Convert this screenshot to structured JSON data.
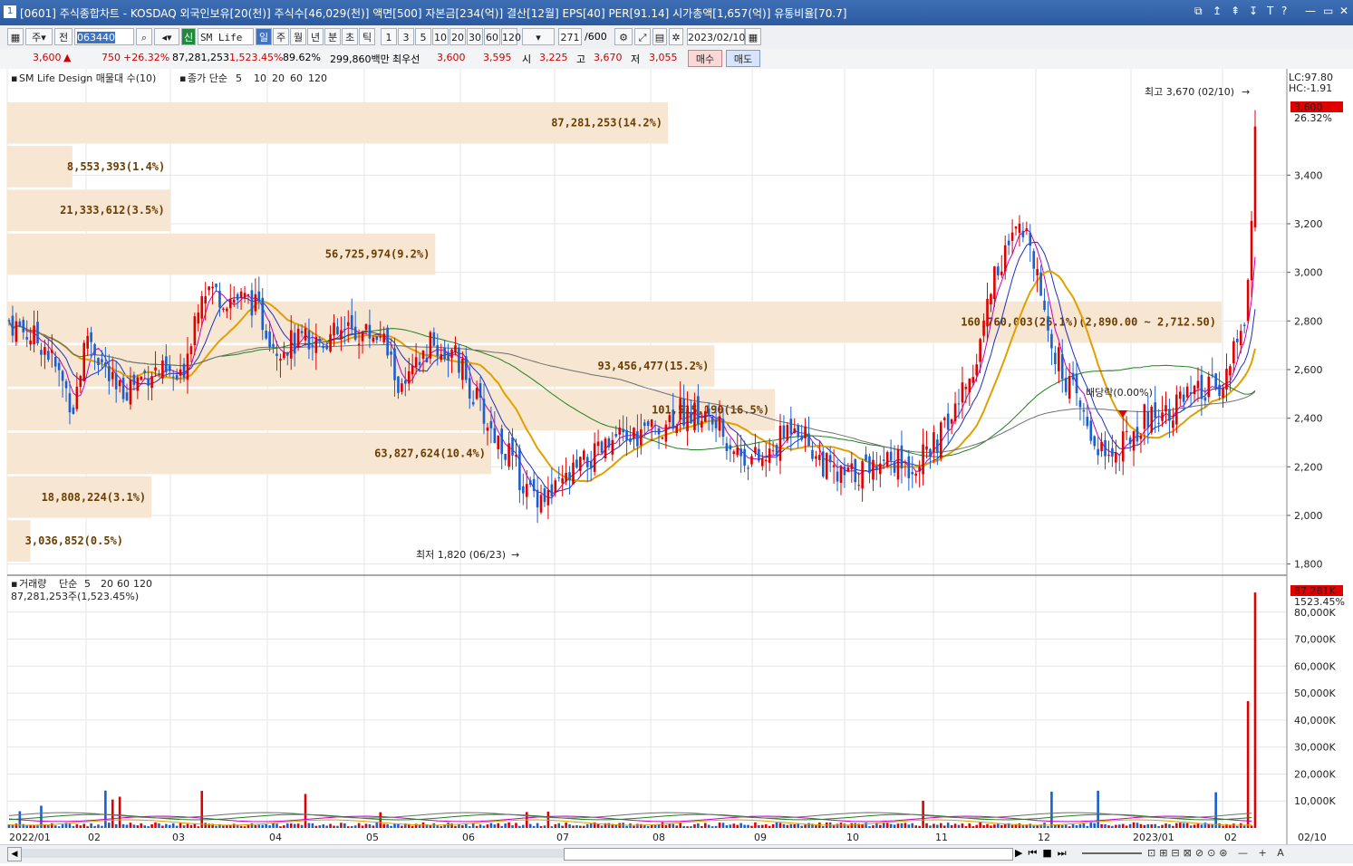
{
  "window": {
    "number": "1",
    "title": "[0601] 주식종합차트 - KOSDAQ 외국인보유[20(천)] 주식수[46,029(천)] 액면[500] 자본금[234(억)] 결산[12월] EPS[40] PER[91.14] 시가총액[1,657(억)] 유통비율[70.7]",
    "controls": [
      "⧉",
      "↥",
      "⇞",
      "↧",
      "T",
      "?",
      "—",
      "▭",
      "✕"
    ]
  },
  "toolbar": {
    "period_label": "주",
    "all_label": "전",
    "code": "063440",
    "badge_new": "신",
    "stock_name": "SM Life De",
    "tabs": [
      "일",
      "주",
      "월",
      "년",
      "분",
      "초",
      "틱"
    ],
    "active_tab": "일",
    "intervals": [
      "1",
      "3",
      "5",
      "10",
      "20",
      "30",
      "60",
      "120"
    ],
    "count": "271",
    "count_total": "/600",
    "date": "2023/02/10"
  },
  "info": {
    "price": "3,600",
    "change_arrow": "▲",
    "change": "750",
    "change_pct": "+26.32%",
    "volume": "87,281,253",
    "volume_pct": "1,523.45%",
    "turnover_pct": "89.62%",
    "amount": "299,860백만",
    "best_quote_label": "최우선",
    "ask": "3,600",
    "bid": "3,595",
    "open_label": "시",
    "open": "3,225",
    "high_label": "고",
    "high": "3,670",
    "low_label": "저",
    "low": "3,055",
    "buy_button": "매수",
    "sell_button": "매도"
  },
  "price_panel": {
    "legend_name": "SM Life Design 매물대 수(10)",
    "legend_ma_label": "종가 단순",
    "ma_periods": [
      "5",
      "10",
      "20",
      "60",
      "120"
    ],
    "ma_colors": [
      "#c000c0",
      "#1f2fbf",
      "#e0a000",
      "#208020",
      "#707070"
    ],
    "lc": "LC:97.80",
    "hc": "HC:-1.91",
    "current_tag": "3,600",
    "current_pct": "26.32%",
    "high_note": "최고 3,670 (02/10)",
    "low_note": "최저 1,820 (06/23)",
    "annotation": "배당락(0.00%)",
    "volume_profile": [
      {
        "label": "87,281,253(14.2%)",
        "upper": 3700,
        "lower": 3530,
        "pct": 14.2
      },
      {
        "label": "8,553,393(1.4%)",
        "upper": 3520,
        "lower": 3350,
        "pct": 1.4
      },
      {
        "label": "21,333,612(3.5%)",
        "upper": 3340,
        "lower": 3170,
        "pct": 3.5
      },
      {
        "label": "56,725,974(9.2%)",
        "upper": 3160,
        "lower": 2990,
        "pct": 9.2
      },
      {
        "label": "160,760,003(26.1%)(2,890.00 ~ 2,712.50)",
        "upper": 2880,
        "lower": 2710,
        "pct": 26.1
      },
      {
        "label": "93,456,477(15.2%)",
        "upper": 2700,
        "lower": 2530,
        "pct": 15.2
      },
      {
        "label": "101,515,190(16.5%)",
        "upper": 2520,
        "lower": 2350,
        "pct": 16.5
      },
      {
        "label": "63,827,624(10.4%)",
        "upper": 2340,
        "lower": 2170,
        "pct": 10.4
      },
      {
        "label": "18,808,224(3.1%)",
        "upper": 2160,
        "lower": 1990,
        "pct": 3.1
      },
      {
        "label": "3,036,852(0.5%)",
        "upper": 1980,
        "lower": 1810,
        "pct": 0.5
      }
    ],
    "y_ticks": [
      "3,400",
      "3,200",
      "3,000",
      "2,800",
      "2,600",
      "2,400",
      "2,200",
      "2,000",
      "1,800"
    ],
    "y_min": 1780,
    "y_max": 3800
  },
  "volume_panel": {
    "legend_name": "거래량",
    "legend_ma_label": "단순",
    "ma_periods": [
      "5",
      "20",
      "60",
      "120"
    ],
    "current_value": "87,281,253주(1,523.45%)",
    "current_tag": "87,281K",
    "current_pct": "1523.45%",
    "y_ticks": [
      "80,000K",
      "70,000K",
      "60,000K",
      "50,000K",
      "40,000K",
      "30,000K",
      "20,000K",
      "10,000K"
    ],
    "y_max": 90000
  },
  "x_labels": [
    "2022/01",
    "02",
    "03",
    "04",
    "05",
    "06",
    "07",
    "08",
    "09",
    "10",
    "11",
    "12",
    "2023/01",
    "02",
    "02/10"
  ],
  "chart_data": {
    "type": "candlestick",
    "title": "SM Life Design",
    "ylim": [
      1780,
      3800
    ],
    "series": [
      {
        "name": "종가",
        "x": [
          "2022/01",
          "2022/02",
          "2022/03",
          "2022/04",
          "2022/05",
          "2022/06",
          "2022/07",
          "2022/08",
          "2022/09",
          "2022/10",
          "2022/11",
          "2022/12",
          "2023/01",
          "2023/02"
        ],
        "values": [
          2800,
          2450,
          2950,
          2700,
          2750,
          2100,
          2300,
          2450,
          2250,
          2150,
          2300,
          3100,
          2400,
          3600
        ]
      }
    ],
    "volume_profile_pct": [
      14.2,
      1.4,
      3.5,
      9.2,
      26.1,
      15.2,
      16.5,
      10.4,
      3.1,
      0.5
    ]
  },
  "bottom": {
    "buttons": [
      "◀",
      "▶",
      "⏮",
      "■",
      "⏭"
    ]
  }
}
